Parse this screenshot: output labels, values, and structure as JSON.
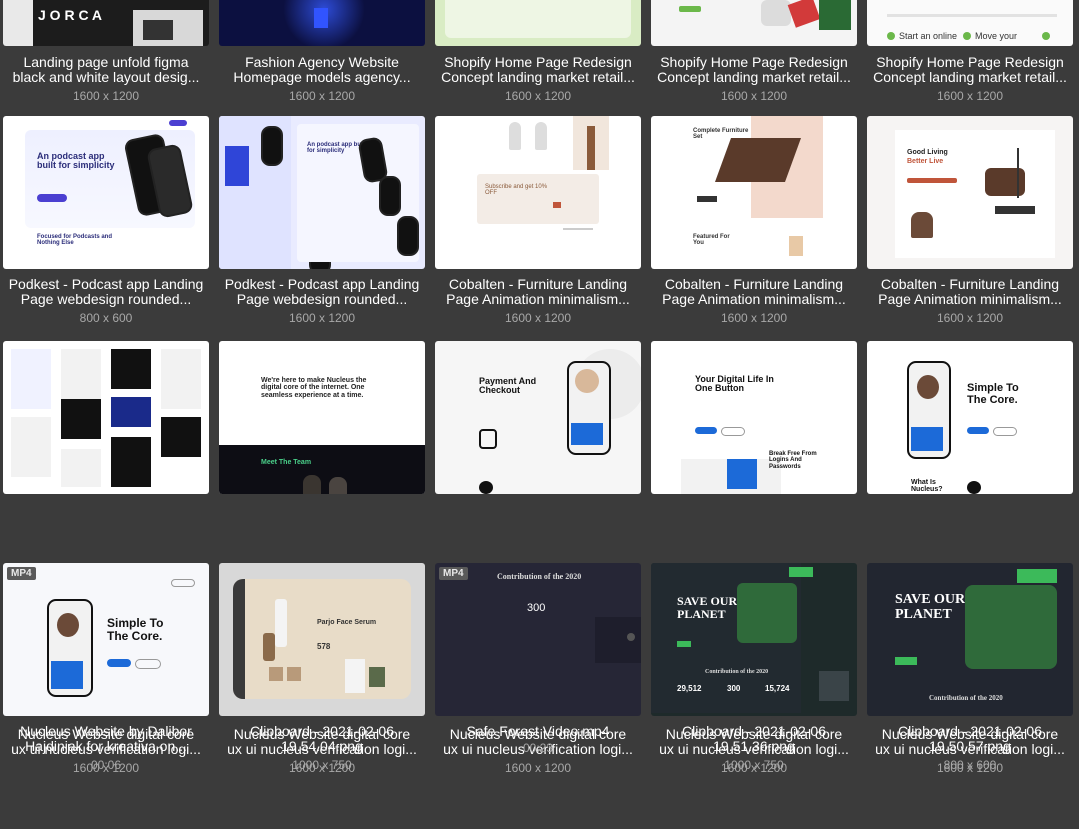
{
  "items": [
    {
      "name": "Landing page unfold figma black and white layout design",
      "line1": "Landing page unfold figma",
      "line2": "black and white layout desig...",
      "meta": "1600 x 1200"
    },
    {
      "name": "Fashion Agency Website Homepage models agency",
      "line1": "Fashion Agency Website",
      "line2": "Homepage models agency...",
      "meta": "1600 x 1200"
    },
    {
      "name": "Shopify Home Page Redesign Concept 1",
      "line1": "Shopify Home Page Redesign",
      "line2": "Concept landing market retail...",
      "meta": "1600 x 1200"
    },
    {
      "name": "Shopify Home Page Redesign Concept 2",
      "line1": "Shopify Home Page Redesign",
      "line2": "Concept landing market retail...",
      "meta": "1600 x 1200",
      "thumb_text": "Start an online",
      "thumb_text2": "Move your"
    },
    {
      "name": "Shopify Home Page Redesign Concept 3",
      "line1": "Shopify Home Page Redesign",
      "line2": "Concept landing market retail...",
      "meta": "1600 x 1200"
    },
    {
      "name": "Podkest 1",
      "line1": "Podkest - Podcast app Landing",
      "line2": "Page webdesign rounded...",
      "meta": "800 x 600",
      "thumb_title": "An podcast app built for simplicity",
      "thumb_sub": "Focused for Podcasts and Nothing Else"
    },
    {
      "name": "Podkest 2",
      "line1": "Podkest - Podcast app Landing",
      "line2": "Page webdesign rounded...",
      "meta": "1600 x 1200",
      "thumb_title": "An podcast app built for simplicity"
    },
    {
      "name": "Cobalten 1",
      "line1": "Cobalten - Furniture Landing",
      "line2": "Page Animation minimalism...",
      "meta": "1600 x 1200",
      "thumb_title": "Subscribe and get 10% OFF"
    },
    {
      "name": "Cobalten 2",
      "line1": "Cobalten - Furniture Landing",
      "line2": "Page Animation minimalism...",
      "meta": "1600 x 1200",
      "thumb_title": "Complete Furniture Set",
      "thumb_sub": "Featured For You"
    },
    {
      "name": "Cobalten 3",
      "line1": "Cobalten - Furniture Landing",
      "line2": "Page Animation minimalism...",
      "meta": "1600 x 1200",
      "thumb_title": "Good Living",
      "thumb_title2": "Better Live"
    },
    {
      "name": "Nucleus 1",
      "line1": "Nucleus Website digital core",
      "line2": "ux ui nucleus verification logi...",
      "meta": "1600 x 1200"
    },
    {
      "name": "Nucleus 2",
      "line1": "Nucleus Website digital core",
      "line2": "ux ui nucleus verification logi...",
      "meta": "1600 x 1200",
      "thumb_title": "We're here to make Nucleus the digital core of the internet. One seamless experience at a time.",
      "thumb_sub": "Meet The Team"
    },
    {
      "name": "Nucleus 3",
      "line1": "Nucleus Website digital core",
      "line2": "ux ui nucleus verification logi...",
      "meta": "1600 x 1200",
      "thumb_title": "Payment And Checkout"
    },
    {
      "name": "Nucleus 4",
      "line1": "Nucleus Website digital core",
      "line2": "ux ui nucleus verification logi...",
      "meta": "1600 x 1200",
      "thumb_title": "Your Digital Life In One Button",
      "thumb_sub": "Break Free From Logins And Passwords"
    },
    {
      "name": "Nucleus 5",
      "line1": "Nucleus Website digital core",
      "line2": "ux ui nucleus verification logi...",
      "meta": "1600 x 1200",
      "thumb_title": "Simple To The Core.",
      "thumb_sub": "What Is Nucleus?"
    },
    {
      "name": "Nucleus Website by Dalibor",
      "line1": "Nucleus Website by Dalibor",
      "line2": "Hajdinjak for kreativa on...",
      "meta": "00:06",
      "badge": "MP4",
      "thumb_title": "Simple To The Core."
    },
    {
      "name": "Clipboard 19.54.04",
      "line1": "Clipboard - 2021-02-06",
      "line2": "19.54.04.png",
      "meta": "1000 x 750",
      "thumb_title": "Parjo Face Serum",
      "thumb_num": "578"
    },
    {
      "name": "Safe Forest Video",
      "line1": "Safe Forest Video.mp4",
      "line2": "",
      "meta": "00:23",
      "badge": "MP4",
      "thumb_title": "Contribution of the 2020",
      "thumb_num": "300"
    },
    {
      "name": "Clipboard 19.51.36",
      "line1": "Clipboard - 2021-02-06",
      "line2": "19.51.36.png",
      "meta": "1000 x 750",
      "thumb_title": "SAVE OUR PLANET",
      "thumb_sub": "Contribution of the 2020",
      "n1": "29,512",
      "n2": "300",
      "n3": "15,724"
    },
    {
      "name": "Clipboard 19.50.57",
      "line1": "Clipboard - 2021-02-06",
      "line2": "19.50.57.png",
      "meta": "800 x 600",
      "thumb_title": "SAVE OUR PLANET",
      "thumb_sub": "Contribution of the 2020"
    }
  ]
}
